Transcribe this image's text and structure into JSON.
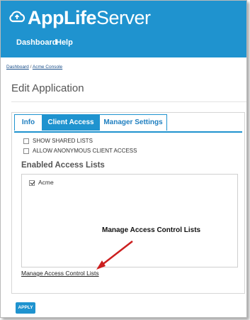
{
  "header": {
    "brand_bold": "AppLife",
    "brand_light": "Server",
    "nav": [
      "Dashboard",
      "Help"
    ],
    "bg_color": "#1f93cf"
  },
  "breadcrumb": {
    "items": [
      "Dashboard",
      "Acme Console"
    ],
    "separator": "/"
  },
  "page": {
    "title": "Edit Application"
  },
  "tabs": [
    {
      "label": "Info",
      "active": false
    },
    {
      "label": "Client Access",
      "active": true
    },
    {
      "label": "Manager Settings",
      "active": false
    }
  ],
  "options": [
    {
      "label": "SHOW SHARED LISTS",
      "checked": false
    },
    {
      "label": "ALLOW ANONYMOUS CLIENT ACCESS",
      "checked": false
    }
  ],
  "section": {
    "title": "Enabled Access Lists"
  },
  "access_lists": [
    {
      "label": "Acme",
      "checked": true
    }
  ],
  "annotation": {
    "text": "Manage Access Control Lists",
    "arrow_color": "#cc1f1f"
  },
  "links": {
    "manage": "Manage Access Control Lists"
  },
  "buttons": {
    "apply": "APPLY"
  },
  "icons": {
    "logo": "cloud-upload-icon"
  }
}
